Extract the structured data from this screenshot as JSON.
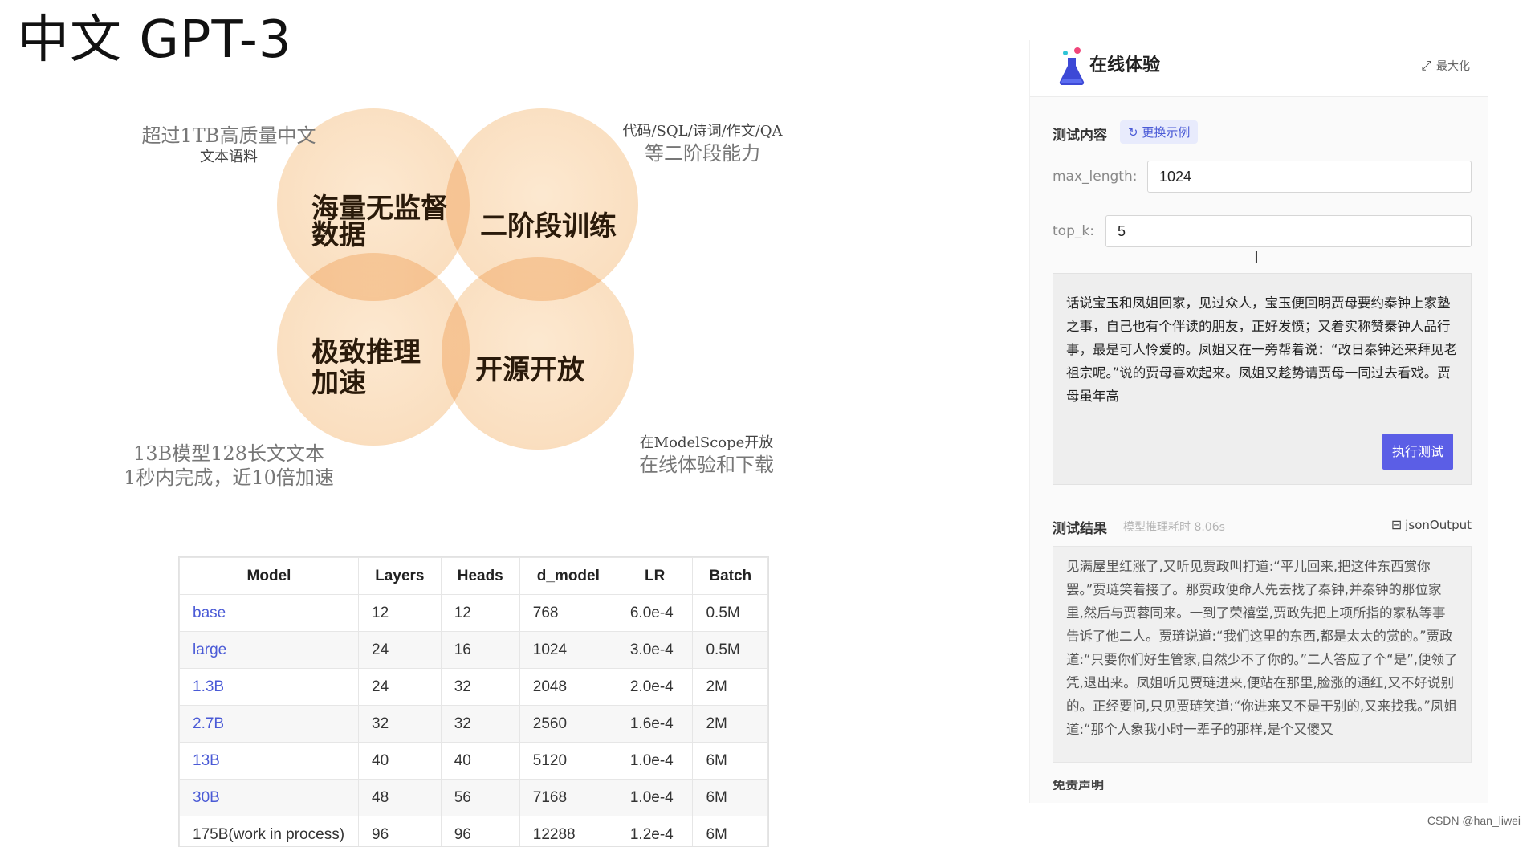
{
  "title": "中文 GPT-3",
  "venn": {
    "circles": [
      "海量无监督\n数据",
      "二阶段训练",
      "极致推理\n加速",
      "开源开放"
    ],
    "notes": {
      "top_left": {
        "big": "超过1TB高质量中文",
        "small": "文本语料"
      },
      "top_right": {
        "small": "代码/SQL/诗词/作文/QA",
        "big": "等二阶段能力"
      },
      "bottom_left": {
        "big1": "13B模型128长文文本",
        "big2": "1秒内完成，近10倍加速"
      },
      "bottom_right": {
        "small": "在ModelScope开放",
        "big": "在线体验和下载"
      }
    }
  },
  "table": {
    "headers": [
      "Model",
      "Layers",
      "Heads",
      "d_model",
      "LR",
      "Batch"
    ],
    "rows": [
      [
        "base",
        "12",
        "12",
        "768",
        "6.0e-4",
        "0.5M"
      ],
      [
        "large",
        "24",
        "16",
        "1024",
        "3.0e-4",
        "0.5M"
      ],
      [
        "1.3B",
        "24",
        "32",
        "2048",
        "2.0e-4",
        "2M"
      ],
      [
        "2.7B",
        "32",
        "32",
        "2560",
        "1.6e-4",
        "2M"
      ],
      [
        "13B",
        "40",
        "40",
        "5120",
        "1.0e-4",
        "6M"
      ],
      [
        "30B",
        "48",
        "56",
        "7168",
        "1.0e-4",
        "6M"
      ],
      [
        "175B(work in process)",
        "96",
        "96",
        "12288",
        "1.2e-4",
        "6M"
      ]
    ]
  },
  "panel": {
    "title": "在线体验",
    "maximize_label": "最大化",
    "test_content_label": "测试内容",
    "change_example_label": "更换示例",
    "max_length_label": "max_length:",
    "max_length_value": "1024",
    "top_k_label": "top_k:",
    "top_k_value": "5",
    "input_text": "话说宝玉和凤姐回家，见过众人，宝玉便回明贾母要约秦钟上家塾之事，自己也有个伴读的朋友，正好发愤；又着实称赞秦钟人品行事，最是可人怜爱的。凤姐又在一旁帮着说：“改日秦钟还来拜见老祖宗呢。”说的贾母喜欢起来。凤姐又趁势请贾母一同过去看戏。贾母虽年高",
    "run_button": "执行测试",
    "result_label": "测试结果",
    "result_time": "模型推理耗时 8.06s",
    "json_output": "jsonOutput",
    "result_text": "见满屋里红涨了,又听见贾政叫打道:“平儿回来,把这件东西赏你罢。”贾琏笑着接了。那贾政便命人先去找了秦钟,并秦钟的那位家里,然后与贾蓉同来。一到了荣禧堂,贾政先把上项所指的家私等事告诉了他二人。贾琏说道:“我们这里的东西,都是太太的赏的。”贾政道:“只要你们好生管家,自然少不了你的。”二人答应了个“是”,便领了凭,退出来。凤姐听见贾琏进来,便站在那里,脸涨的通红,又不好说别的。正经要问,只见贾琏笑道:“你进来又不是干别的,又来找我。”凤姐道:“那个人象我小时一辈子的那样,是个又傻又",
    "bottom_label": "免责声明"
  },
  "credit": "CSDN @han_liwei",
  "colors": {
    "accent": "#5b5ee6",
    "link": "#4a5ad6",
    "venn": "#f6c48c"
  }
}
